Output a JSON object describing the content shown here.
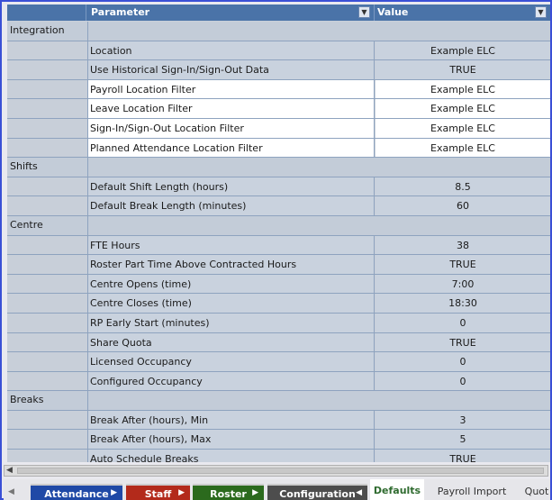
{
  "header": {
    "col_param": "Parameter",
    "col_value": "Value"
  },
  "rows": [
    {
      "type": "category",
      "label": "Integration"
    },
    {
      "type": "item",
      "param": "Location",
      "value": "Example ELC",
      "highlight": false
    },
    {
      "type": "item",
      "param": "Use Historical Sign-In/Sign-Out Data",
      "value": "TRUE",
      "highlight": false
    },
    {
      "type": "item",
      "param": "Payroll Location Filter",
      "value": "Example ELC",
      "highlight": true
    },
    {
      "type": "item",
      "param": "Leave Location Filter",
      "value": "Example ELC",
      "highlight": true
    },
    {
      "type": "item",
      "param": "Sign-In/Sign-Out Location Filter",
      "value": "Example ELC",
      "highlight": true
    },
    {
      "type": "item",
      "param": "Planned Attendance Location Filter",
      "value": "Example ELC",
      "highlight": true
    },
    {
      "type": "category",
      "label": "Shifts"
    },
    {
      "type": "item",
      "param": "Default Shift Length (hours)",
      "value": "8.5",
      "highlight": false
    },
    {
      "type": "item",
      "param": "Default Break Length (minutes)",
      "value": "60",
      "highlight": false
    },
    {
      "type": "category",
      "label": "Centre"
    },
    {
      "type": "item",
      "param": "FTE Hours",
      "value": "38",
      "highlight": false
    },
    {
      "type": "item",
      "param": "Roster Part Time Above Contracted Hours",
      "value": "TRUE",
      "highlight": false
    },
    {
      "type": "item",
      "param": "Centre Opens (time)",
      "value": "7:00",
      "highlight": false
    },
    {
      "type": "item",
      "param": "Centre Closes (time)",
      "value": "18:30",
      "highlight": false
    },
    {
      "type": "item",
      "param": "RP Early Start (minutes)",
      "value": "0",
      "highlight": false
    },
    {
      "type": "item",
      "param": "Share Quota",
      "value": "TRUE",
      "highlight": false
    },
    {
      "type": "item",
      "param": "Licensed Occupancy",
      "value": "0",
      "highlight": false
    },
    {
      "type": "item",
      "param": "Configured Occupancy",
      "value": "0",
      "highlight": false
    },
    {
      "type": "category",
      "label": "Breaks"
    },
    {
      "type": "item",
      "param": "Break After (hours), Min",
      "value": "3",
      "highlight": false
    },
    {
      "type": "item",
      "param": "Break After (hours), Max",
      "value": "5",
      "highlight": false
    },
    {
      "type": "item",
      "param": "Auto Schedule Breaks",
      "value": "TRUE",
      "highlight": false
    }
  ],
  "tabs": [
    {
      "label": "Attendance",
      "color": "#1f49a6",
      "style": "colored"
    },
    {
      "label": "Staff",
      "color": "#b32a1b",
      "style": "colored"
    },
    {
      "label": "Roster",
      "color": "#2b6a1d",
      "style": "colored"
    },
    {
      "label": "Configuration",
      "color": "#4d4d4d",
      "style": "colored"
    },
    {
      "label": "Defaults",
      "style": "active"
    },
    {
      "label": "Payroll Import",
      "style": "plain"
    },
    {
      "label": "Quot",
      "style": "plain"
    }
  ]
}
